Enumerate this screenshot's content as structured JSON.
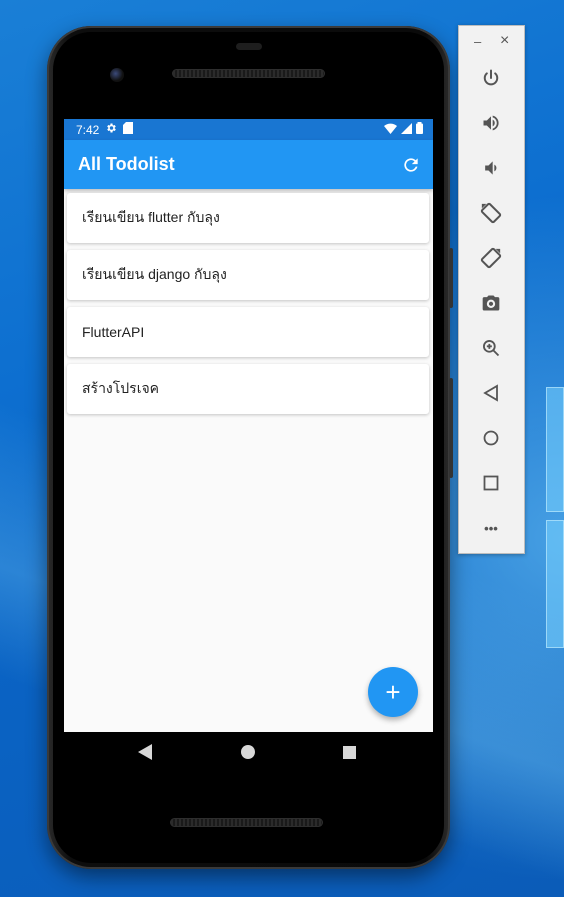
{
  "status_bar": {
    "time": "7:42"
  },
  "app_bar": {
    "title": "All Todolist"
  },
  "todos": [
    "เรียนเขียน flutter กับลุง",
    "เรียนเขียน django กับลุง",
    "FlutterAPI",
    "สร้างโปรเจค"
  ],
  "fab": {
    "label": "+"
  },
  "emulator_toolbar": {
    "minimize_label": "–",
    "close_label": "×",
    "buttons": [
      "power",
      "volume-up",
      "volume-down",
      "rotate-left",
      "rotate-right",
      "screenshot",
      "zoom",
      "back",
      "home",
      "overview",
      "more"
    ],
    "more_label": "•••"
  },
  "colors": {
    "app_bar": "#2196f3",
    "status_bar": "#1976d2",
    "fab": "#2196f3",
    "background": "#fafafa"
  }
}
